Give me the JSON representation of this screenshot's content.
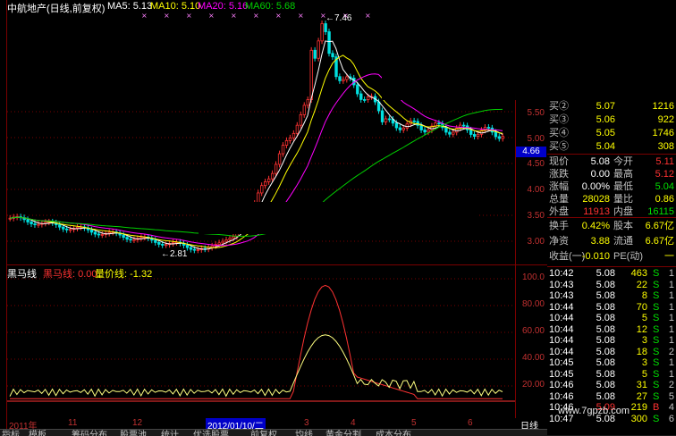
{
  "header": {
    "stock_title": "中航地产(日线,前复权)",
    "ma5": "MA5: 5.13",
    "ma10": "MA10: 5.10",
    "ma20": "MA20: 5.16",
    "ma60": "MA60: 5.68"
  },
  "main_chart": {
    "high_label": "7.46",
    "low_label": "2.81",
    "price_ticks": [
      "5.50",
      "5.00",
      "4.50",
      "4.00",
      "3.50",
      "3.00"
    ],
    "current_price_tag": "4.66"
  },
  "indicator": {
    "name": "黑马线",
    "line1": "黑马线: 0.00",
    "line2": "量价线: -1.32",
    "ticks": [
      "100.0",
      "80.00",
      "60.00",
      "40.00",
      "20.00"
    ]
  },
  "date_axis": {
    "labels": [
      "2011年",
      "11",
      "12",
      "2012/01/10/二",
      "3",
      "4",
      "5",
      "6"
    ],
    "period": "日线"
  },
  "tabs": [
    "指标",
    "模板",
    "筹码分布",
    "股票池",
    "统计",
    "优选股票",
    "前复权",
    "均线",
    "黄金分割",
    "成本分布"
  ],
  "quote": {
    "bids": [
      {
        "label": "买②",
        "price": "5.07",
        "vol": "1216"
      },
      {
        "label": "买③",
        "price": "5.06",
        "vol": "922"
      },
      {
        "label": "买④",
        "price": "5.05",
        "vol": "1746"
      },
      {
        "label": "买⑤",
        "price": "5.04",
        "vol": "308"
      }
    ],
    "stats": [
      {
        "l1": "现价",
        "v1": "5.08",
        "l2": "今开",
        "v2": "5.11"
      },
      {
        "l1": "涨跌",
        "v1": "0.00",
        "l2": "最高",
        "v2": "5.12"
      },
      {
        "l1": "涨幅",
        "v1": "0.00%",
        "l2": "最低",
        "v2": "5.04"
      },
      {
        "l1": "总量",
        "v1": "28028",
        "l2": "量比",
        "v2": "0.86"
      },
      {
        "l1": "外盘",
        "v1": "11913",
        "l2": "内盘",
        "v2": "16115"
      }
    ],
    "stats2": [
      {
        "l1": "换手",
        "v1": "0.42%",
        "l2": "股本",
        "v2": "6.67亿"
      },
      {
        "l1": "净资",
        "v1": "3.88",
        "l2": "流通",
        "v2": "6.67亿"
      },
      {
        "l1": "收益(一)",
        "v1": "-0.010",
        "l2": "PE(动)",
        "v2": "一"
      }
    ],
    "ticks": [
      {
        "time": "10:42",
        "price": "5.08",
        "vol": "463",
        "side": "S",
        "n": "1"
      },
      {
        "time": "10:43",
        "price": "5.08",
        "vol": "22",
        "side": "S",
        "n": "1"
      },
      {
        "time": "10:43",
        "price": "5.08",
        "vol": "8",
        "side": "S",
        "n": "1"
      },
      {
        "time": "10:44",
        "price": "5.08",
        "vol": "70",
        "side": "S",
        "n": "1"
      },
      {
        "time": "10:44",
        "price": "5.08",
        "vol": "5",
        "side": "S",
        "n": "1"
      },
      {
        "time": "10:44",
        "price": "5.08",
        "vol": "12",
        "side": "S",
        "n": "1"
      },
      {
        "time": "10:44",
        "price": "5.08",
        "vol": "3",
        "side": "S",
        "n": "1"
      },
      {
        "time": "10:44",
        "price": "5.08",
        "vol": "18",
        "side": "S",
        "n": "2"
      },
      {
        "time": "10:45",
        "price": "5.08",
        "vol": "3",
        "side": "S",
        "n": "1"
      },
      {
        "time": "10:45",
        "price": "5.08",
        "vol": "5",
        "side": "S",
        "n": "1"
      },
      {
        "time": "10:46",
        "price": "5.08",
        "vol": "31",
        "side": "S",
        "n": "2"
      },
      {
        "time": "10:46",
        "price": "5.08",
        "vol": "27",
        "side": "S",
        "n": "5"
      },
      {
        "time": "10:46",
        "price": "5.09",
        "vol": "219",
        "side": "B",
        "n": "4"
      },
      {
        "time": "10:47",
        "price": "5.08",
        "vol": "300",
        "side": "S",
        "n": "6"
      }
    ]
  },
  "watermark": "www.7gpzb.com",
  "colors": {
    "up": "#ff3232",
    "down": "#00e0e0",
    "ma5": "#ffffff",
    "ma10": "#ffff00",
    "ma20": "#ff00ff",
    "ma60": "#00d000",
    "grid": "#7a0000",
    "yellow": "#ffff00",
    "price_green": "#00e000"
  }
}
